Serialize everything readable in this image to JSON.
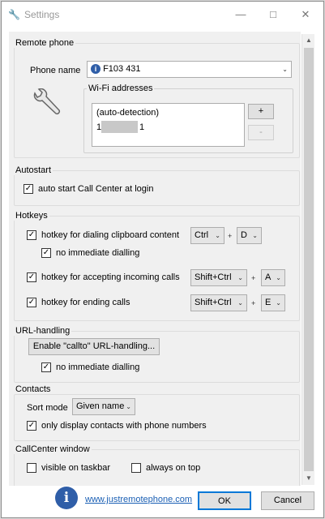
{
  "window": {
    "title": "Settings"
  },
  "remote_phone": {
    "group_label": "Remote phone",
    "phone_name_label": "Phone name",
    "phone_name_value": "F103 431",
    "wifi_group_label": "Wi-Fi addresses",
    "wifi_items": [
      "(auto-detection)",
      "1",
      "1"
    ],
    "add_button": "+",
    "remove_button": "-"
  },
  "autostart": {
    "group_label": "Autostart",
    "auto_start_label": "auto start Call Center at login",
    "auto_start_checked": true
  },
  "hotkeys": {
    "group_label": "Hotkeys",
    "dial_clipboard_label": "hotkey for dialing clipboard content",
    "dial_modifier": "Ctrl",
    "dial_key": "D",
    "no_immediate_label": "no immediate dialling",
    "accept_label": "hotkey for accepting incoming calls",
    "accept_modifier": "Shift+Ctrl",
    "accept_key": "A",
    "end_label": "hotkey for ending calls",
    "end_modifier": "Shift+Ctrl",
    "end_key": "E",
    "plus": "+"
  },
  "url_handling": {
    "group_label": "URL-handling",
    "enable_button": "Enable \"callto\" URL-handling...",
    "no_immediate_label": "no immediate dialling"
  },
  "contacts": {
    "group_label": "Contacts",
    "sort_mode_label": "Sort mode",
    "sort_mode_value": "Given name",
    "only_phone_label": "only display contacts with phone numbers"
  },
  "callcenter_window": {
    "group_label": "CallCenter window",
    "visible_taskbar_label": "visible on taskbar",
    "always_on_top_label": "always on top"
  },
  "footer": {
    "link": "www.justremotephone.com",
    "ok": "OK",
    "cancel": "Cancel"
  },
  "colors": {
    "link": "#1a5fb4",
    "info_icon": "#2f5ea8"
  }
}
